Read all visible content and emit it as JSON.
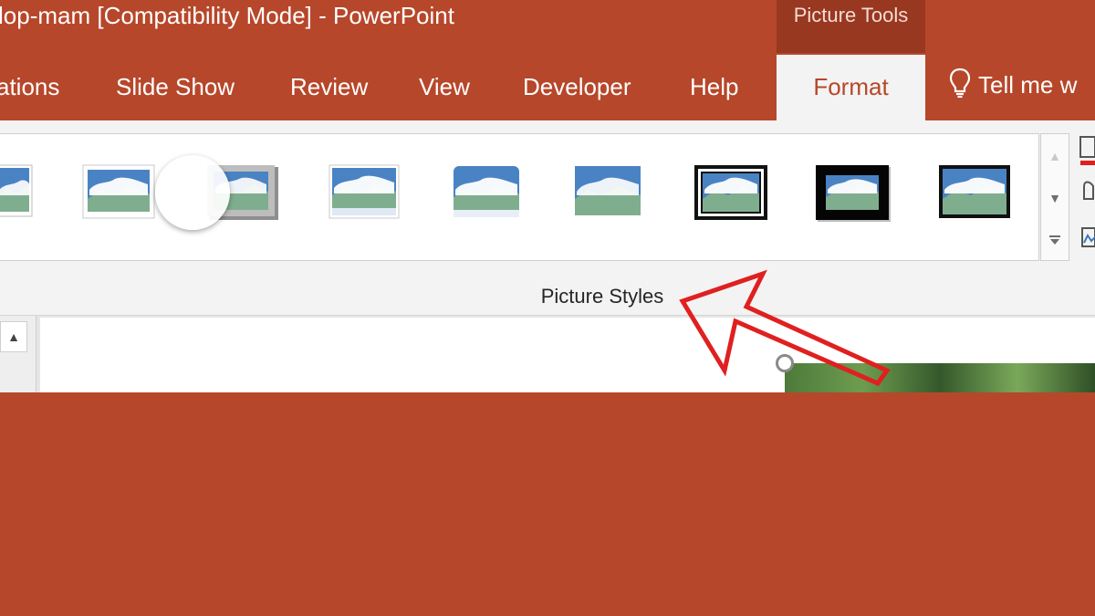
{
  "window": {
    "title": "lop-mam [Compatibility Mode]  -  PowerPoint",
    "context_tab_group": "Picture Tools"
  },
  "ribbon": {
    "tabs": [
      {
        "label": "ations"
      },
      {
        "label": "Slide Show"
      },
      {
        "label": "Review"
      },
      {
        "label": "View"
      },
      {
        "label": "Developer"
      },
      {
        "label": "Help"
      }
    ],
    "active_tab": "Format",
    "tell_me": "Tell me w"
  },
  "picture_styles": {
    "group_label": "Picture Styles",
    "gallery_item_count": 9
  },
  "colors": {
    "brand": "#b7472a",
    "context_tab_bg": "#993821",
    "ribbon_bg": "#f3f3f3",
    "annotation_arrow": "#e02020"
  },
  "icons": {
    "lightbulb": "lightbulb-icon",
    "gallery_up": "chevron-up-icon",
    "gallery_down": "chevron-down-icon",
    "gallery_more": "expand-gallery-icon",
    "pane_scroll_up": "triangle-up-icon",
    "rotation_handle": "rotate-handle-icon",
    "annotation": "red-arrow-icon"
  }
}
